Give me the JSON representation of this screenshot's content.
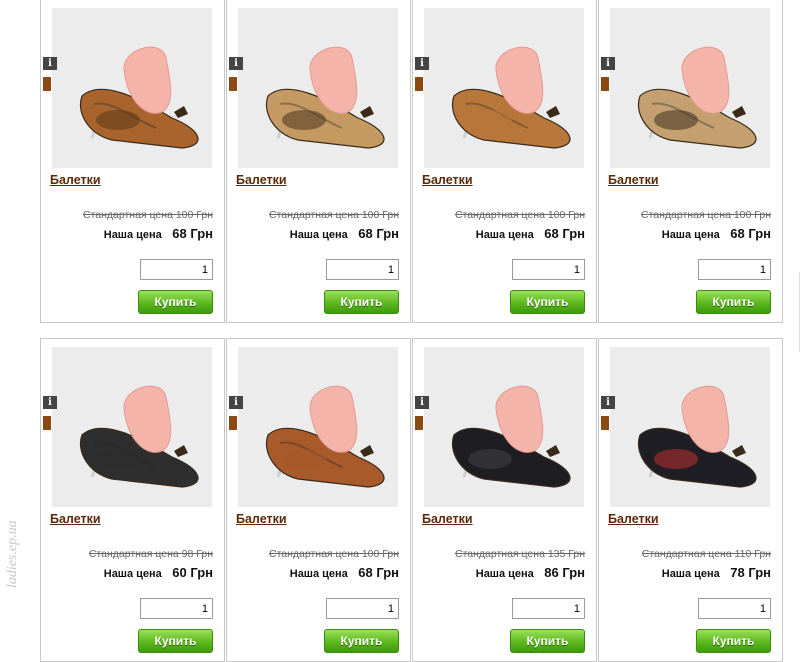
{
  "watermark": "ladies.ep.ua",
  "currency_note": "Грн",
  "products": [
    {
      "title": "Балетки",
      "old_price": "Стандартная цена 100 Грн",
      "price_label": "Наша цена",
      "price": "68 Грн",
      "qty": "1",
      "buy_label": "Купить",
      "shoe_color": "#a8642c",
      "pattern_color": "#5a3a1a",
      "photo_icon": "flat-shoe-leopard-brown-photo"
    },
    {
      "title": "Балетки",
      "old_price": "Стандартная цена 100 Грн",
      "price_label": "Наша цена",
      "price": "68 Грн",
      "qty": "1",
      "buy_label": "Купить",
      "shoe_color": "#c49a62",
      "pattern_color": "#4a3420",
      "photo_icon": "flat-shoe-leopard-beige-photo"
    },
    {
      "title": "Балетки",
      "old_price": "Стандартная цена 100 Грн",
      "price_label": "Наша цена",
      "price": "68 Грн",
      "qty": "1",
      "buy_label": "Купить",
      "shoe_color": "#b8773a",
      "pattern_color": "#b8773a",
      "photo_icon": "flat-shoe-tan-photo"
    },
    {
      "title": "Балетки",
      "old_price": "Стандартная цена 100 Грн",
      "price_label": "Наша цена",
      "price": "68 Грн",
      "qty": "1",
      "buy_label": "Купить",
      "shoe_color": "#c4a070",
      "pattern_color": "#3f3020",
      "photo_icon": "flat-shoe-leopard-beige-photo"
    },
    {
      "title": "Балетки",
      "old_price": "Стандартная цена 98 Грн",
      "price_label": "Наша цена",
      "price": "60 Грн",
      "qty": "1",
      "buy_label": "Купить",
      "shoe_color": "#2e2e2e",
      "pattern_color": "#2e2e2e",
      "photo_icon": "flat-shoe-black-photo"
    },
    {
      "title": "Балетки",
      "old_price": "Стандартная цена 100 Грн",
      "price_label": "Наша цена",
      "price": "68 Грн",
      "qty": "1",
      "buy_label": "Купить",
      "shoe_color": "#a85a2a",
      "pattern_color": "#a85a2a",
      "photo_icon": "flat-shoe-brown-photo"
    },
    {
      "title": "Балетки",
      "old_price": "Стандартная цена 135 Грн",
      "price_label": "Наша цена",
      "price": "86 Грн",
      "qty": "1",
      "buy_label": "Купить",
      "shoe_color": "#1e1e22",
      "pattern_color": "#444",
      "photo_icon": "flat-shoe-black-perforated-photo"
    },
    {
      "title": "Балетки",
      "old_price": "Стандартная цена 110 Грн",
      "price_label": "Наша цена",
      "price": "78 Грн",
      "qty": "1",
      "buy_label": "Купить",
      "shoe_color": "#1e1e24",
      "pattern_color": "#c03030",
      "photo_icon": "flat-shoe-black-red-dots-photo"
    }
  ]
}
